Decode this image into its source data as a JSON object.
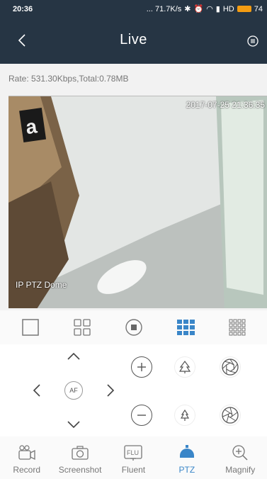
{
  "status_bar": {
    "time": "20:36",
    "indicators": "... 71.7K/s",
    "network": "HD",
    "battery": "74"
  },
  "header": {
    "title": "Live",
    "back_icon": "chevron-left-icon",
    "menu_icon": "menu-circle-icon"
  },
  "rate": "Rate: 531.30Kbps,Total:0.78MB",
  "video": {
    "timestamp": "2017-07-25 21:36:35",
    "camera_name": "IP PTZ Dome"
  },
  "layouts": [
    {
      "name": "single-view-icon",
      "active": false
    },
    {
      "name": "four-view-icon",
      "active": false
    },
    {
      "name": "stop-icon",
      "active": false
    },
    {
      "name": "nine-view-icon",
      "active": true
    },
    {
      "name": "sixteen-view-icon",
      "active": false
    }
  ],
  "ptz": {
    "af_label": "AF"
  },
  "nav": {
    "active_color": "#3a86c8",
    "items": [
      {
        "label": "Record",
        "icon": "record-icon"
      },
      {
        "label": "Screenshot",
        "icon": "camera-icon"
      },
      {
        "label": "Fluent",
        "icon": "fluent-icon",
        "badge": "FLU"
      },
      {
        "label": "PTZ",
        "icon": "ptz-dome-icon",
        "active": true
      },
      {
        "label": "Magnify",
        "icon": "magnify-icon"
      }
    ]
  }
}
